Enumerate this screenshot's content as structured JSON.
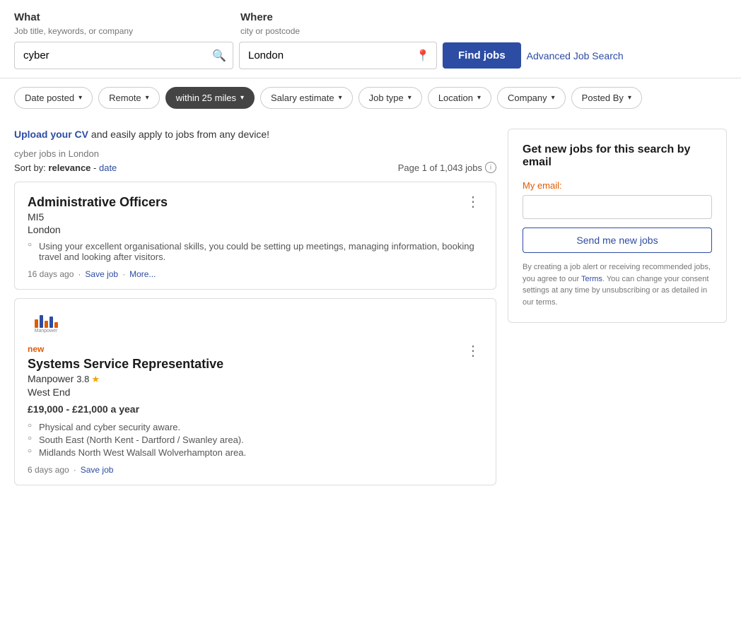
{
  "search": {
    "what_label": "What",
    "what_sublabel": "Job title, keywords, or company",
    "where_label": "Where",
    "where_sublabel": "city or postcode",
    "what_value": "cyber",
    "where_value": "London",
    "find_jobs_label": "Find jobs",
    "advanced_link": "Advanced Job Search"
  },
  "filters": [
    {
      "id": "date-posted",
      "label": "Date posted",
      "active": false
    },
    {
      "id": "remote",
      "label": "Remote",
      "active": false
    },
    {
      "id": "within-25-miles",
      "label": "within 25 miles",
      "active": true
    },
    {
      "id": "salary-estimate",
      "label": "Salary estimate",
      "active": false
    },
    {
      "id": "job-type",
      "label": "Job type",
      "active": false
    },
    {
      "id": "location",
      "label": "Location",
      "active": false
    },
    {
      "id": "company",
      "label": "Company",
      "active": false
    },
    {
      "id": "posted-by",
      "label": "Posted By",
      "active": false
    }
  ],
  "upload_cv_text": "Upload your CV",
  "upload_cv_rest": " and easily apply to jobs from any device!",
  "results_meta": "cyber jobs in London",
  "sort_label": "Sort by:",
  "sort_relevance": "relevance",
  "sort_dash": " - ",
  "sort_date": "date",
  "page_info": "Page 1 of 1,043 jobs",
  "jobs": [
    {
      "title": "Administrative Officers",
      "company": "MI5",
      "location": "London",
      "description": [
        "Using your excellent organisational skills, you could be setting up meetings, managing information, booking travel and looking after visitors."
      ],
      "posted": "16 days ago",
      "save_label": "Save job",
      "more_label": "More...",
      "new_badge": "",
      "salary": "",
      "rating": "",
      "logo": false
    },
    {
      "title": "Systems Service Representative",
      "company": "Manpower",
      "location": "West End",
      "description": [
        "Physical and cyber security aware.",
        "South East (North Kent - Dartford / Swanley area).",
        "Midlands North West Walsall Wolverhampton area."
      ],
      "posted": "6 days ago",
      "save_label": "Save job",
      "more_label": "",
      "new_badge": "new",
      "salary": "£19,000 - £21,000 a year",
      "rating": "3.8",
      "logo": true
    }
  ],
  "sidebar": {
    "title": "Get new jobs for this search by email",
    "email_label": "My email:",
    "send_label": "Send me new jobs",
    "consent": "By creating a job alert or receiving recommended jobs, you agree to our ",
    "terms_link": "Terms",
    "consent_rest": ". You can change your consent settings at any time by unsubscribing or as detailed in our terms."
  }
}
